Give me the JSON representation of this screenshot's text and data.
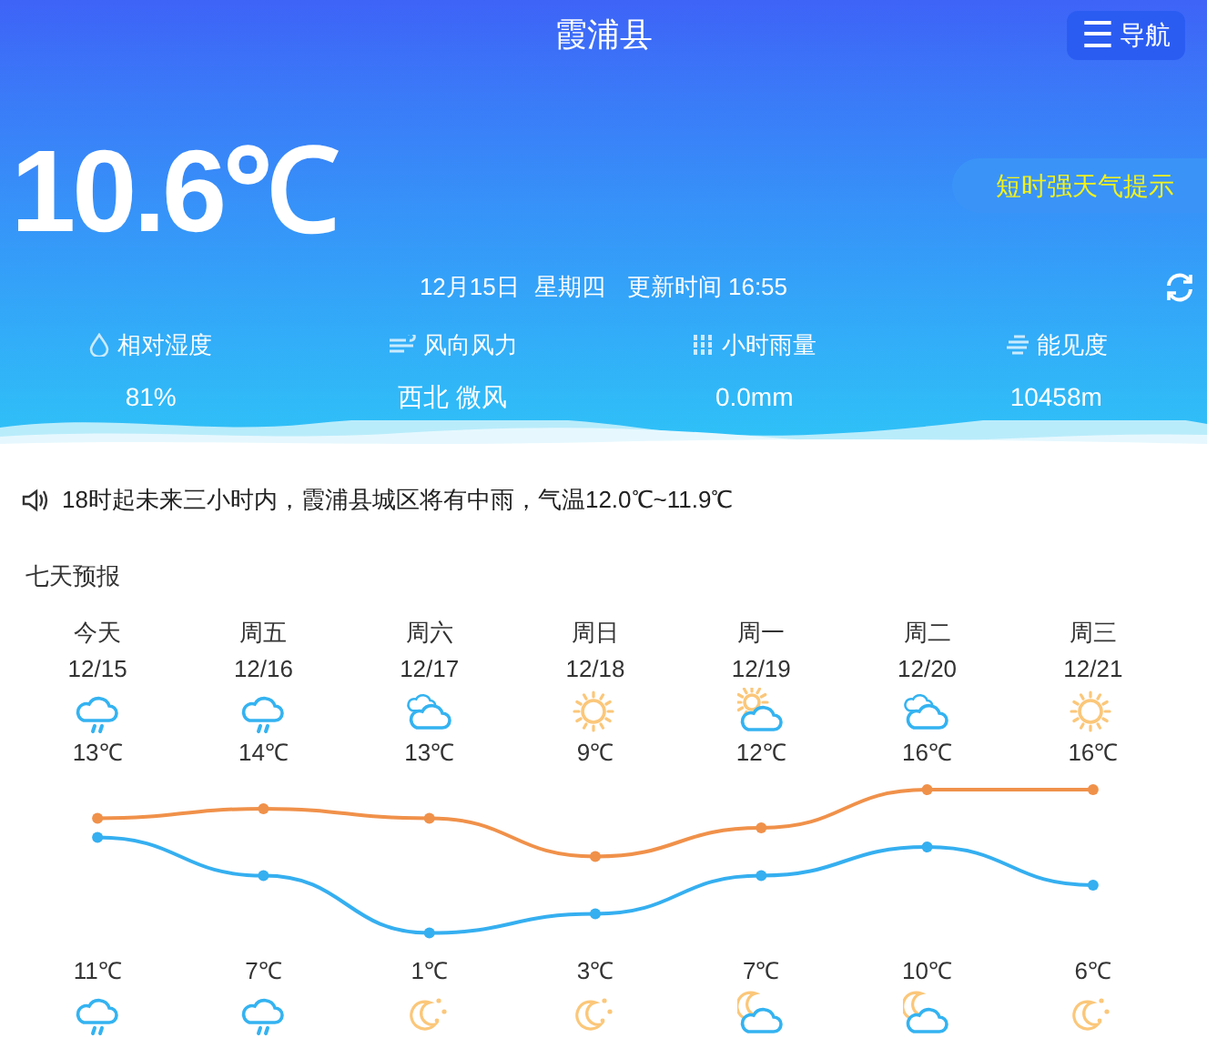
{
  "header": {
    "title": "霞浦县",
    "nav_button": {
      "icon": "☰",
      "label": "导航"
    },
    "temperature": "10.6℃",
    "alert_button": "短时强天气提示",
    "date": "12月15日",
    "weekday": "星期四",
    "update_time": "更新时间 16:55"
  },
  "stats": [
    {
      "kind": "humidity",
      "label": "相对湿度",
      "value": "81%"
    },
    {
      "kind": "wind",
      "label": "风向风力",
      "value": "西北 微风"
    },
    {
      "kind": "rain",
      "label": "小时雨量",
      "value": "0.0mm"
    },
    {
      "kind": "visibility",
      "label": "能见度",
      "value": "10458m"
    }
  ],
  "notice": "18时起未来三小时内，霞浦县城区将有中雨，气温12.0℃~11.9℃",
  "forecast": {
    "title": "七天预报",
    "days": [
      {
        "day": "今天",
        "date": "12/15",
        "day_weather": {
          "kind": "rain"
        },
        "high": "13℃",
        "low": "11℃",
        "night_weather": {
          "kind": "rain"
        }
      },
      {
        "day": "周五",
        "date": "12/16",
        "day_weather": {
          "kind": "rain"
        },
        "high": "14℃",
        "low": "7℃",
        "night_weather": {
          "kind": "rain"
        }
      },
      {
        "day": "周六",
        "date": "12/17",
        "day_weather": {
          "kind": "cloudy"
        },
        "high": "13℃",
        "low": "1℃",
        "night_weather": {
          "kind": "moon"
        }
      },
      {
        "day": "周日",
        "date": "12/18",
        "day_weather": {
          "kind": "sunny"
        },
        "high": "9℃",
        "low": "3℃",
        "night_weather": {
          "kind": "moon"
        }
      },
      {
        "day": "周一",
        "date": "12/19",
        "day_weather": {
          "kind": "suncloud"
        },
        "high": "12℃",
        "low": "7℃",
        "night_weather": {
          "kind": "mooncloud"
        }
      },
      {
        "day": "周二",
        "date": "12/20",
        "day_weather": {
          "kind": "cloudy"
        },
        "high": "16℃",
        "low": "10℃",
        "night_weather": {
          "kind": "mooncloud"
        }
      },
      {
        "day": "周三",
        "date": "12/21",
        "day_weather": {
          "kind": "sunny"
        },
        "high": "16℃",
        "low": "6℃",
        "night_weather": {
          "kind": "moon"
        }
      }
    ]
  }
}
